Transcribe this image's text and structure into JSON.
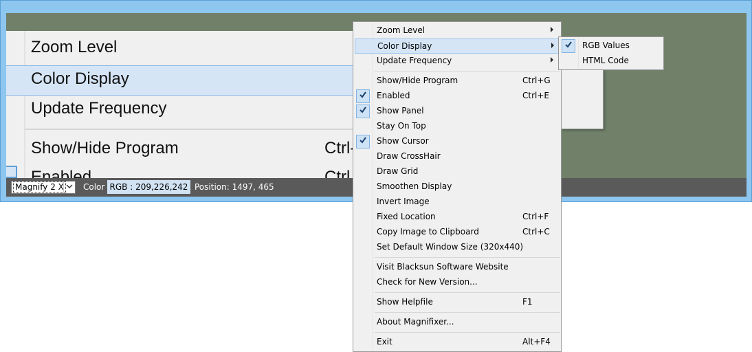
{
  "magnifier": {
    "menu_items": {
      "zoom_level": "Zoom Level",
      "color_display": "Color Display",
      "update_frequency": "Update Frequency",
      "show_hide_program": "Show/Hide Program",
      "show_hide_shortcut": "Ctrl-",
      "enabled_partial": "Enabled",
      "enabled_shortcut_partial": "Ctrl"
    },
    "background_color": "#708069"
  },
  "statusbar": {
    "zoom_value": "Magnify 2 X",
    "color_label": "Color",
    "rgb_value": "RGB : 209,226,242",
    "position_text": "Position: 1497, 465"
  },
  "context_menu": {
    "items": [
      {
        "label": "Zoom Level",
        "submenu": true
      },
      {
        "label": "Color Display",
        "submenu": true,
        "highlighted": true
      },
      {
        "label": "Update Frequency",
        "submenu": true
      },
      {
        "label": "Show/Hide Program",
        "shortcut": "Ctrl+G"
      },
      {
        "label": "Enabled",
        "shortcut": "Ctrl+E",
        "checked": true
      },
      {
        "label": "Show Panel",
        "checked": true
      },
      {
        "label": "Stay On Top"
      },
      {
        "label": "Show Cursor",
        "checked": true
      },
      {
        "label": "Draw CrossHair"
      },
      {
        "label": "Draw Grid"
      },
      {
        "label": "Smoothen Display"
      },
      {
        "label": "Invert Image"
      },
      {
        "label": "Fixed Location",
        "shortcut": "Ctrl+F"
      },
      {
        "label": "Copy Image to Clipboard",
        "shortcut": "Ctrl+C"
      },
      {
        "label": "Set Default Window Size (320x440)"
      },
      {
        "label": "Visit Blacksun Software Website"
      },
      {
        "label": "Check for New Version..."
      },
      {
        "label": "Show Helpfile",
        "shortcut": "F1"
      },
      {
        "label": "About Magnifixer..."
      },
      {
        "label": "Exit",
        "shortcut": "Alt+F4"
      }
    ]
  },
  "submenu": {
    "items": [
      {
        "label": "RGB Values",
        "checked": true
      },
      {
        "label": "HTML Code"
      }
    ]
  },
  "icons": {
    "check": "checkmark-icon",
    "submenu_arrow": "chevron-right-icon",
    "dropdown_arrow": "chevron-down-icon"
  }
}
